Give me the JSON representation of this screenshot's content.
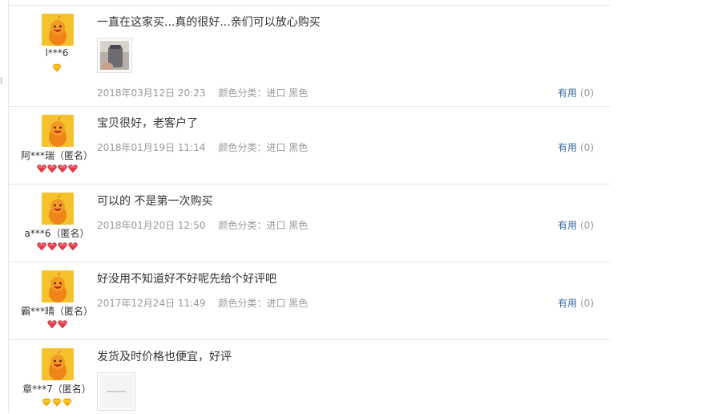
{
  "left_rail": {
    "stub_char": "吧"
  },
  "reviews": [
    {
      "user": "l***6",
      "comment": "一直在这家买...真的很好...亲们可以放心购买",
      "has_photo": true,
      "date": "2018年03月12日 20:23",
      "variant": "颜色分类：进口 黑色",
      "useful_label": "有用",
      "useful_count": "(0)",
      "badge_type": "diamond-gold",
      "badge_count": 1
    },
    {
      "user": "阿***瑞（匿名）",
      "comment": "宝贝很好，老客户了",
      "has_photo": false,
      "date": "2018年01月19日 11:14",
      "variant": "颜色分类：进口 黑色",
      "useful_label": "有用",
      "useful_count": "(0)",
      "badge_type": "heart-red",
      "badge_count": 4
    },
    {
      "user": "a***6（匿名）",
      "comment": "可以的 不是第一次购买",
      "has_photo": false,
      "date": "2018年01月20日 12:50",
      "variant": "颜色分类：进口 黑色",
      "useful_label": "有用",
      "useful_count": "(0)",
      "badge_type": "heart-red",
      "badge_count": 4
    },
    {
      "user": "霸***晴（匿名）",
      "comment": "好没用不知道好不好呢先给个好评吧",
      "has_photo": false,
      "date": "2017年12月24日 11:49",
      "variant": "颜色分类：进口 黑色",
      "useful_label": "有用",
      "useful_count": "(0)",
      "badge_type": "heart-red",
      "badge_count": 2
    },
    {
      "user": "章***7（匿名）",
      "comment": "发货及时价格也便宜，好评",
      "has_photo": true,
      "date": "",
      "variant": "",
      "useful_label": "",
      "useful_count": "",
      "badge_type": "diamond-gold",
      "badge_count": 3
    }
  ]
}
